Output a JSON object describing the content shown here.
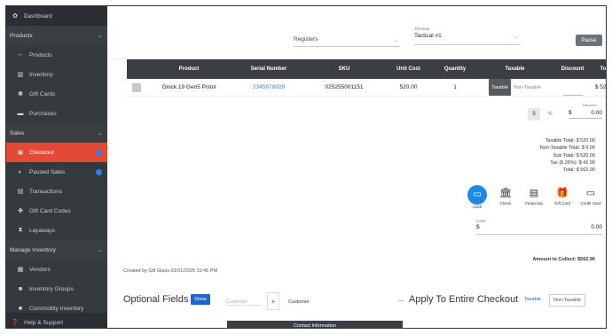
{
  "sidebar": {
    "dashboard": "Dashboard",
    "products_head": "Products",
    "products_items": [
      "Products",
      "Inventory",
      "Gift Cards",
      "Purchases"
    ],
    "sales_head": "Sales",
    "sales_items": [
      "Checkout",
      "Paused Sales",
      "Transactions",
      "Gift Card Codes",
      "Layaways"
    ],
    "manage_head": "Manage Inventory",
    "manage_items": [
      "Vendors",
      "Inventory Groups",
      "Commodity Inventory"
    ],
    "help": "Help & Support"
  },
  "topbar": {
    "register": "Registers",
    "terminal_label": "Terminal",
    "terminal": "Tactical #1",
    "pause": "Pause"
  },
  "table": {
    "headers": [
      "Product",
      "Serial Number",
      "SKU",
      "Unit Cost",
      "Quantity",
      "Taxable",
      "Discount",
      "Total"
    ],
    "row": {
      "product": "Glock 19 Gen5 Pistol",
      "serial": "2345678928",
      "sku": "025255001151",
      "unit_cost": "520.00",
      "quantity": "1",
      "taxable": "Taxable",
      "non_taxable": "Non-Taxable",
      "total": "$ 520.00"
    }
  },
  "discount": {
    "dollar": "$",
    "percent": "%",
    "label": "Discount",
    "symbol": "$",
    "amount": "0.00"
  },
  "totals": [
    "Taxable Total: $ 520.00",
    "Non-Taxable Total: $ 0.00",
    "Sub Total: $ 520.00",
    "Tax (8.25%): $ 42.90",
    "Total: $ 562.90"
  ],
  "tenders": [
    {
      "label": "Cash",
      "icon": "cash-icon"
    },
    {
      "label": "Check",
      "icon": "bank-icon"
    },
    {
      "label": "Financing",
      "icon": "document-icon"
    },
    {
      "label": "Gift Card",
      "icon": "gift-icon"
    },
    {
      "label": "Credit Card",
      "icon": "card-reader-icon"
    }
  ],
  "cash": {
    "label": "Cash",
    "symbol": "$",
    "value": "0.00"
  },
  "amount_to_collect": "Amount to Collect: $562.90",
  "created_by": "Created by GB Glass 03/31/2025 10:45 PM",
  "optional": {
    "title": "Optional Fields",
    "show": "Show",
    "customer_placeholder": "Customer",
    "add": "+",
    "customer_label": "Customer",
    "apply_title": "Apply To Entire Checkout",
    "taxable": "Taxable",
    "non_taxable": "Non-Taxable"
  },
  "contact_bar": "Contact Information"
}
